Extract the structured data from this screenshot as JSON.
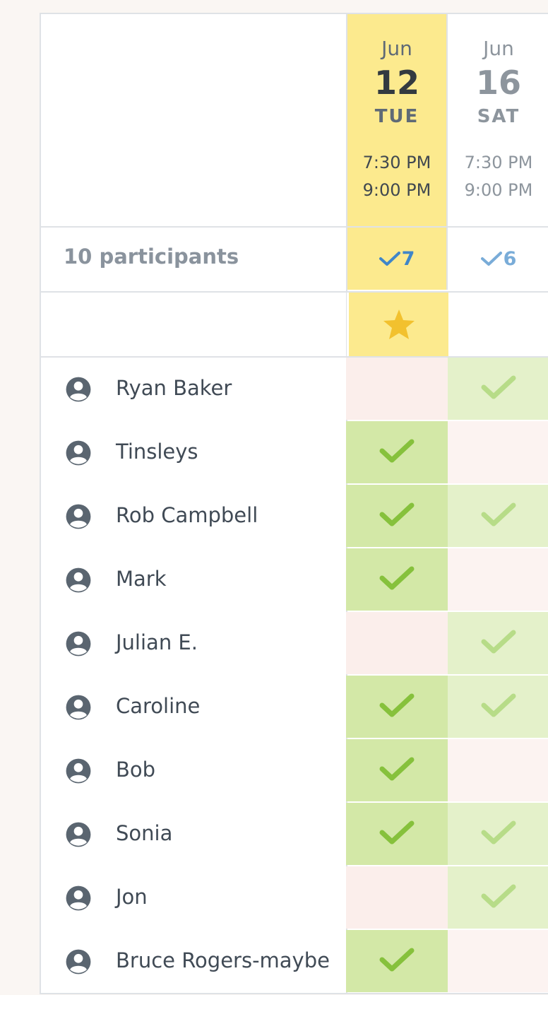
{
  "participants_label": "10 participants",
  "columns": [
    {
      "month": "Jun",
      "day": "12",
      "weekday": "TUE",
      "start": "7:30 PM",
      "end": "9:00 PM",
      "count": "7",
      "best": true
    },
    {
      "month": "Jun",
      "day": "16",
      "weekday": "SAT",
      "start": "7:30 PM",
      "end": "9:00 PM",
      "count": "6",
      "best": false
    }
  ],
  "participants": [
    {
      "name": "Ryan Baker",
      "answers": [
        "no",
        "yes"
      ]
    },
    {
      "name": "Tinsleys",
      "answers": [
        "yes",
        "no"
      ]
    },
    {
      "name": "Rob Campbell",
      "answers": [
        "yes",
        "yes"
      ]
    },
    {
      "name": "Mark",
      "answers": [
        "yes",
        "no"
      ]
    },
    {
      "name": "Julian E.",
      "answers": [
        "no",
        "yes"
      ]
    },
    {
      "name": "Caroline",
      "answers": [
        "yes",
        "yes"
      ]
    },
    {
      "name": "Bob",
      "answers": [
        "yes",
        "no"
      ]
    },
    {
      "name": "Sonia",
      "answers": [
        "yes",
        "yes"
      ]
    },
    {
      "name": "Jon",
      "answers": [
        "no",
        "yes"
      ]
    },
    {
      "name": "Bruce Rogers-maybe",
      "answers": [
        "yes",
        "no"
      ]
    }
  ],
  "icons": {
    "avatar": "user-circle-icon",
    "check": "check-icon",
    "star": "star-icon"
  },
  "colors": {
    "best_column": "#fcea8e",
    "yes_strong": "#d3e8a7",
    "yes_weak": "#e4f1ca",
    "no": "#fbeeeb",
    "check_strong": "#86c13c",
    "check_weak": "#b7dc88",
    "star": "#f2c12e",
    "count_check": "#3f86c9"
  }
}
